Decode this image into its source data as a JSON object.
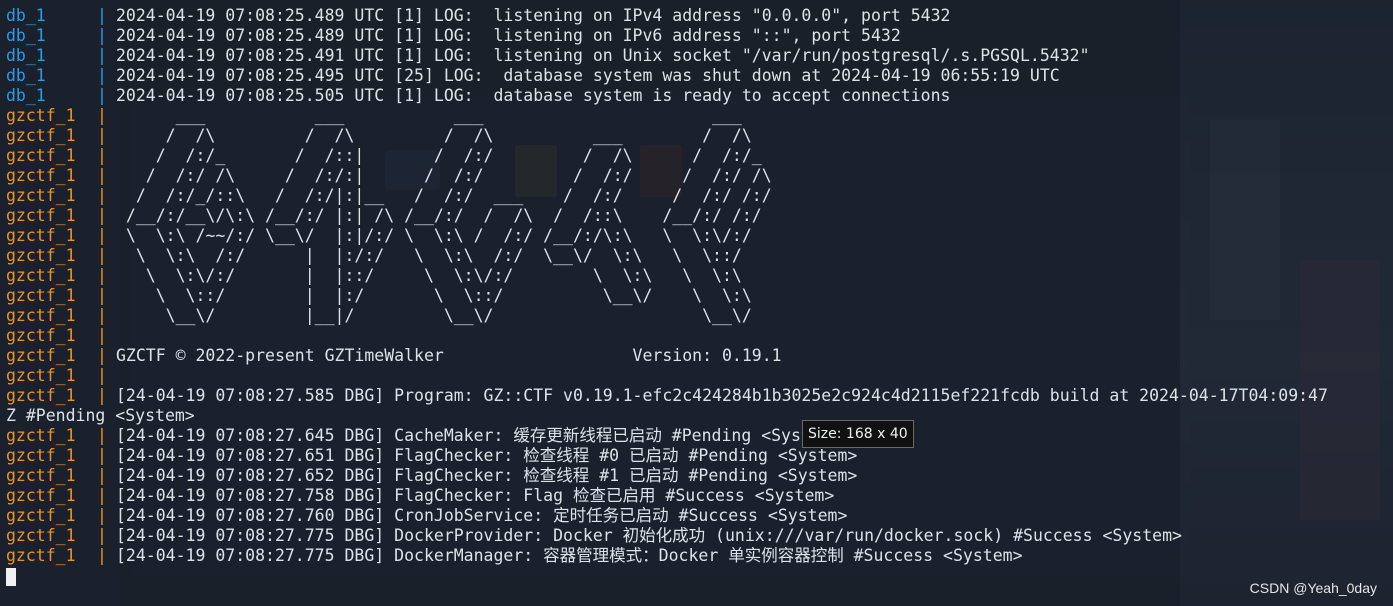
{
  "terminal": {
    "lines": [
      {
        "service": "db_1",
        "kind": "db",
        "text": "2024-04-19 07:08:25.489 UTC [1] LOG:  listening on IPv4 address \"0.0.0.0\", port 5432"
      },
      {
        "service": "db_1",
        "kind": "db",
        "text": "2024-04-19 07:08:25.489 UTC [1] LOG:  listening on IPv6 address \"::\", port 5432"
      },
      {
        "service": "db_1",
        "kind": "db",
        "text": "2024-04-19 07:08:25.491 UTC [1] LOG:  listening on Unix socket \"/var/run/postgresql/.s.PGSQL.5432\""
      },
      {
        "service": "db_1",
        "kind": "db",
        "text": "2024-04-19 07:08:25.495 UTC [25] LOG:  database system was shut down at 2024-04-19 06:55:19 UTC"
      },
      {
        "service": "db_1",
        "kind": "db",
        "text": "2024-04-19 07:08:25.505 UTC [1] LOG:  database system is ready to accept connections"
      },
      {
        "service": "gzctf_1",
        "kind": "gz",
        "text": "      ___           ___           ___                       ___     "
      },
      {
        "service": "gzctf_1",
        "kind": "gz",
        "text": "     /  /\\         /  /\\         /  /\\          ___        /  /\\    "
      },
      {
        "service": "gzctf_1",
        "kind": "gz",
        "text": "    /  /:/_       /  /::|       /  /:/         /  /\\      /  /:/_   "
      },
      {
        "service": "gzctf_1",
        "kind": "gz",
        "text": "   /  /:/ /\\     /  /:/:|      /  /:/         /  /:/     /  /:/ /\\  "
      },
      {
        "service": "gzctf_1",
        "kind": "gz",
        "text": "  /  /:/_/::\\   /  /:/|:|__   /  /:/  ___    /  /:/     /  /:/ /:/  "
      },
      {
        "service": "gzctf_1",
        "kind": "gz",
        "text": " /__/:/__\\/\\:\\ /__/:/ |:| /\\ /__/:/  /  /\\  /  /::\\    /__/:/ /:/   "
      },
      {
        "service": "gzctf_1",
        "kind": "gz",
        "text": " \\  \\:\\ /~~/:/ \\__\\/  |:|/:/ \\  \\:\\ /  /:/ /__/:/\\:\\   \\  \\:\\/:/    "
      },
      {
        "service": "gzctf_1",
        "kind": "gz",
        "text": "  \\  \\:\\  /:/      |  |:/:/   \\  \\:\\  /:/  \\__\\/  \\:\\   \\  \\::/     "
      },
      {
        "service": "gzctf_1",
        "kind": "gz",
        "text": "   \\  \\:\\/:/       |  |::/     \\  \\:\\/:/        \\  \\:\\   \\  \\:\\     "
      },
      {
        "service": "gzctf_1",
        "kind": "gz",
        "text": "    \\  \\::/        |  |:/       \\  \\::/          \\__\\/    \\  \\:\\    "
      },
      {
        "service": "gzctf_1",
        "kind": "gz",
        "text": "     \\__\\/         |__|/         \\__\\/                     \\__\\/    "
      },
      {
        "service": "gzctf_1",
        "kind": "gz",
        "text": ""
      },
      {
        "service": "gzctf_1",
        "kind": "gz",
        "text": "GZCTF © 2022-present GZTimeWalker                   Version: 0.19.1"
      },
      {
        "service": "gzctf_1",
        "kind": "gz",
        "text": ""
      },
      {
        "service": "gzctf_1",
        "kind": "gz",
        "text": "[24-04-19 07:08:27.585 DBG] Program: GZ::CTF v0.19.1-efc2c424284b1b3025e2c924c4d2115ef221fcdb build at 2024-04-17T04:09:47"
      },
      {
        "service": "",
        "kind": "wrap",
        "text": "Z #Pending <System>"
      },
      {
        "service": "gzctf_1",
        "kind": "gz",
        "text": "[24-04-19 07:08:27.645 DBG] CacheMaker: 缓存更新线程已启动 #Pending <System>"
      },
      {
        "service": "gzctf_1",
        "kind": "gz",
        "text": "[24-04-19 07:08:27.651 DBG] FlagChecker: 检查线程 #0 已启动 #Pending <System>"
      },
      {
        "service": "gzctf_1",
        "kind": "gz",
        "text": "[24-04-19 07:08:27.652 DBG] FlagChecker: 检查线程 #1 已启动 #Pending <System>"
      },
      {
        "service": "gzctf_1",
        "kind": "gz",
        "text": "[24-04-19 07:08:27.758 DBG] FlagChecker: Flag 检查已启用 #Success <System>"
      },
      {
        "service": "gzctf_1",
        "kind": "gz",
        "text": "[24-04-19 07:08:27.760 DBG] CronJobService: 定时任务已启动 #Success <System>"
      },
      {
        "service": "gzctf_1",
        "kind": "gz",
        "text": "[24-04-19 07:08:27.775 DBG] DockerProvider: Docker 初始化成功 (unix:///var/run/docker.sock) #Success <System>"
      },
      {
        "service": "gzctf_1",
        "kind": "gz",
        "text": "[24-04-19 07:08:27.775 DBG] DockerManager: 容器管理模式：Docker 单实例容器控制 #Success <System>"
      }
    ]
  },
  "tooltip": {
    "text": "Size: 168 x 40"
  },
  "watermark": {
    "text": "CSDN @Yeah_0day"
  },
  "colors": {
    "db_service": "#2d9be8",
    "gz_service": "#e8932a",
    "text": "#dde2e8"
  }
}
